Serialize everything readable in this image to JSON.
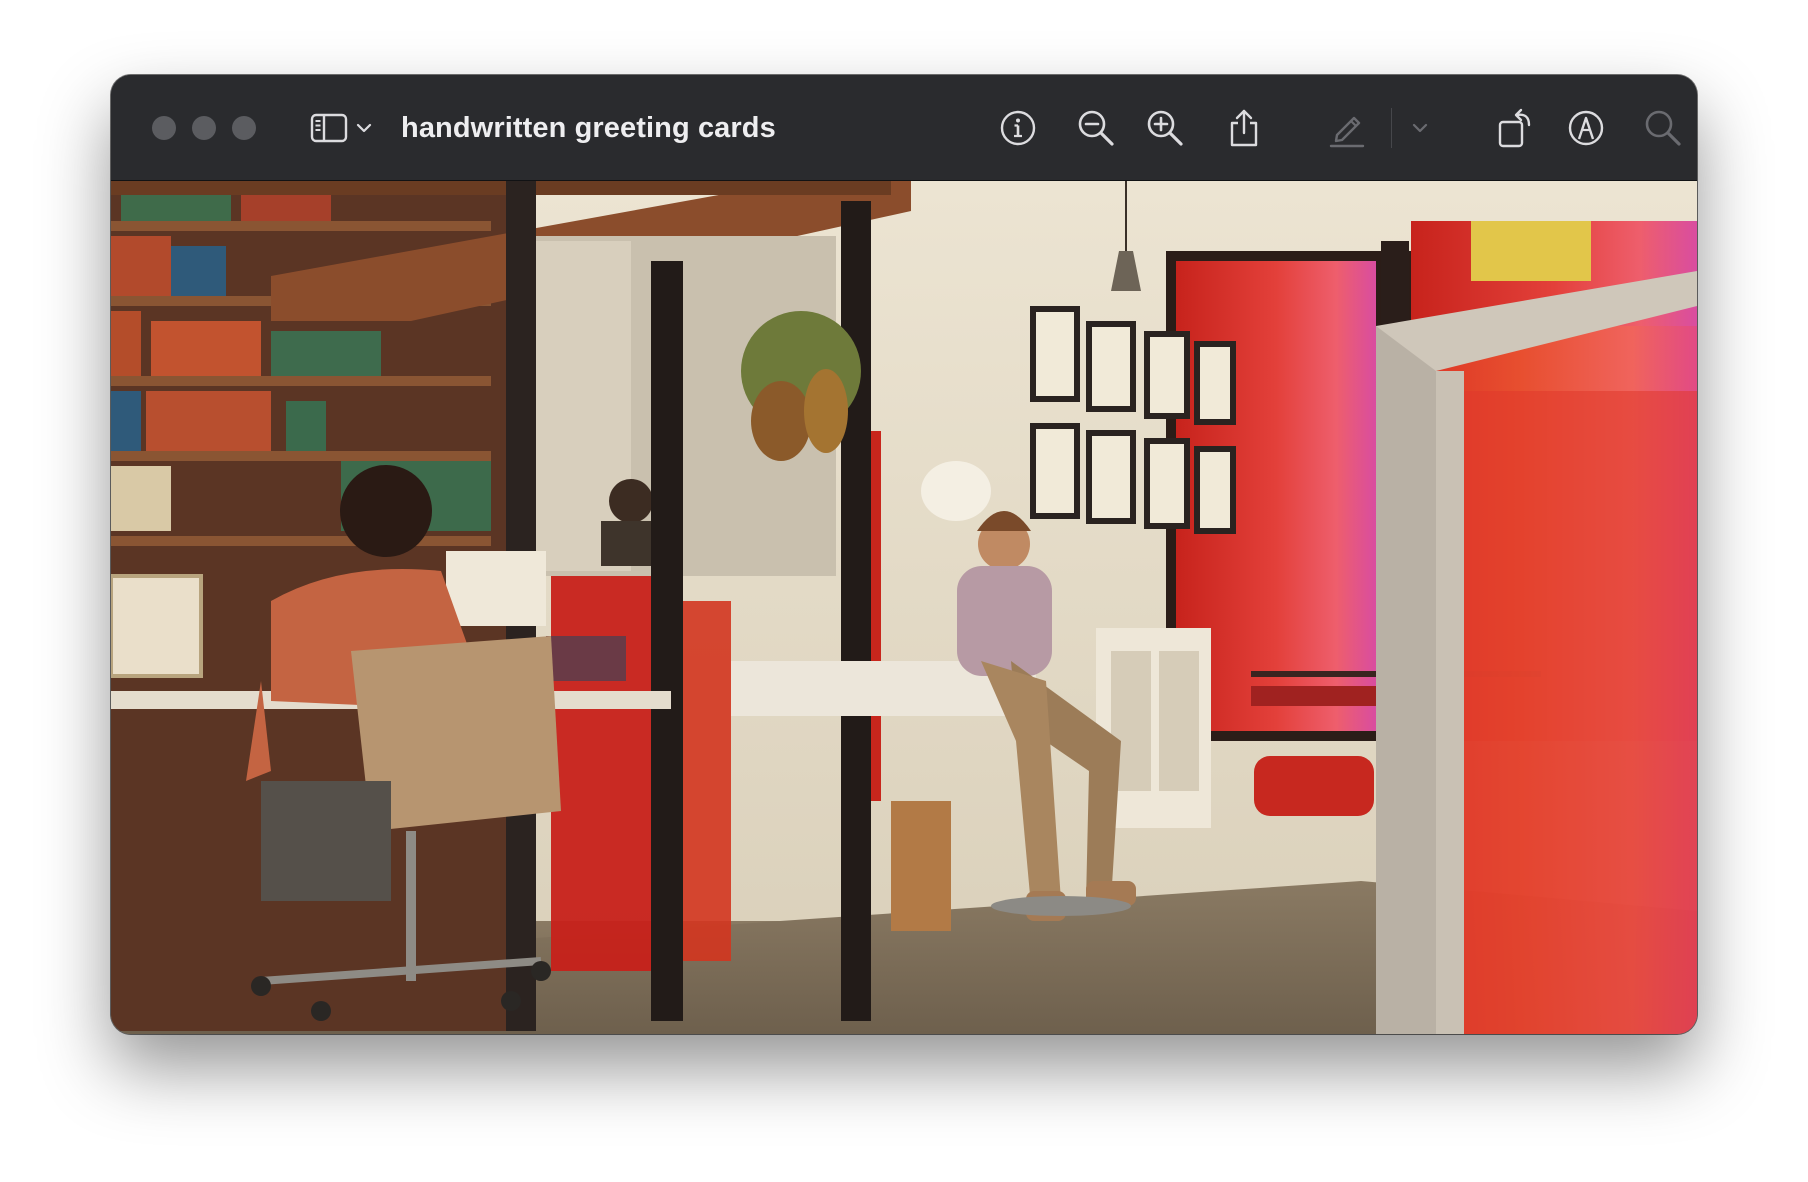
{
  "window": {
    "title": "handwritten greeting cards"
  },
  "toolbar": {
    "sidebar_toggle_icon": "sidebar-icon",
    "sidebar_menu_icon": "chevron-down-icon",
    "info_icon": "info-circle-icon",
    "zoom_out_icon": "zoom-out-icon",
    "zoom_in_icon": "zoom-in-icon",
    "share_icon": "share-icon",
    "markup_icon": "pencil-icon",
    "markup_menu_icon": "chevron-down-icon",
    "rotate_icon": "rotate-left-icon",
    "annotate_icon": "markup-pen-circle-icon",
    "search_icon": "search-icon"
  },
  "colors": {
    "titlebar": "#2a2b2e",
    "title_text": "#eeeef0",
    "icon": "#dcdcdf",
    "icon_disabled": "#6a6b70",
    "traffic_light_inactive": "#5b5c60"
  },
  "image": {
    "description_icon": "photo"
  }
}
